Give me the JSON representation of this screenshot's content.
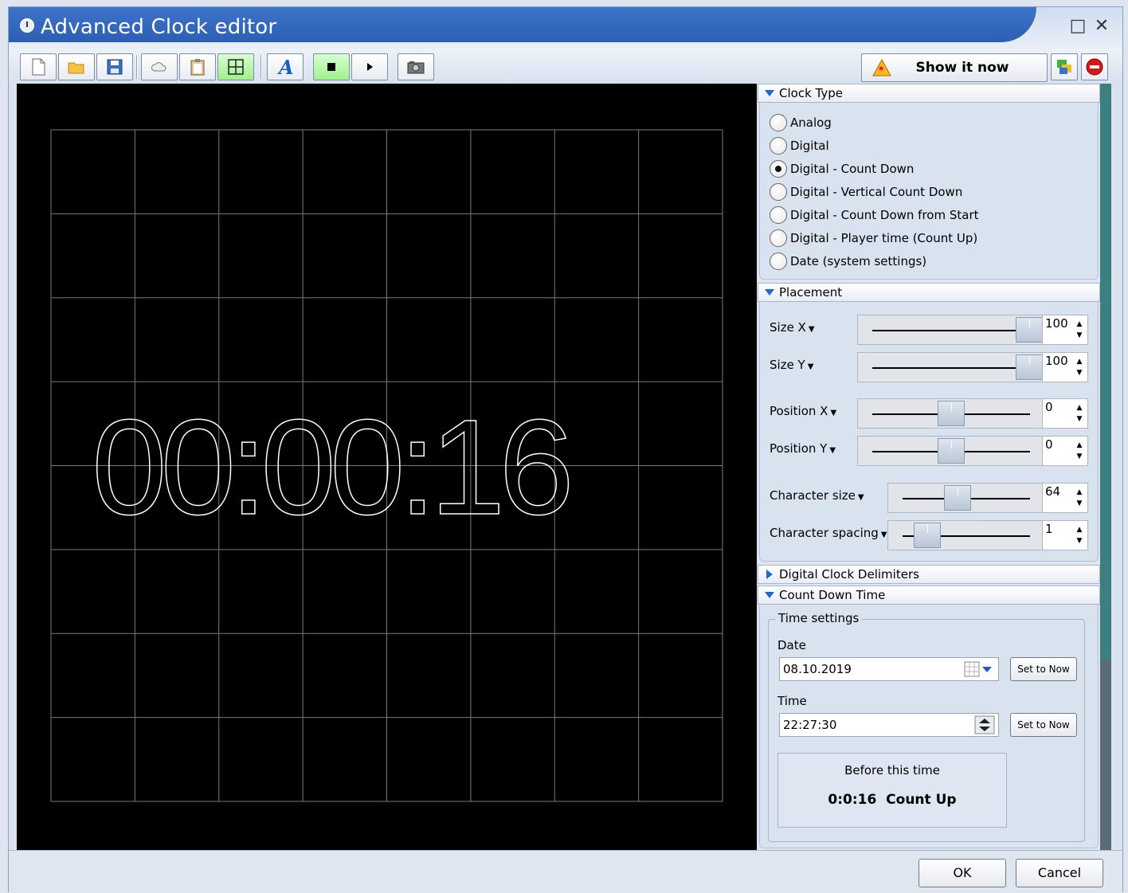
{
  "window": {
    "title": "Advanced Clock editor"
  },
  "toolbar": {
    "show_now_label": "Show it now"
  },
  "canvas": {
    "clock_text": "00:00:16",
    "grid": {
      "columns": 8,
      "rows": 8
    },
    "background": "#000000",
    "foreground": "#ffffff"
  },
  "clock_type": {
    "header": "Clock Type",
    "options": [
      {
        "label": "Analog",
        "checked": false
      },
      {
        "label": "Digital",
        "checked": false
      },
      {
        "label": "Digital - Count Down",
        "checked": true
      },
      {
        "label": "Digital - Vertical Count Down",
        "checked": false
      },
      {
        "label": "Digital - Count Down from Start",
        "checked": false
      },
      {
        "label": "Digital - Player time (Count Up)",
        "checked": false
      },
      {
        "label": "Date (system settings)",
        "checked": false
      }
    ]
  },
  "placement": {
    "header": "Placement",
    "size_x": {
      "label": "Size X",
      "value": "100"
    },
    "size_y": {
      "label": "Size Y",
      "value": "100"
    },
    "position_x": {
      "label": "Position X",
      "value": "0"
    },
    "position_y": {
      "label": "Position Y",
      "value": "0"
    },
    "char_size": {
      "label": "Character size",
      "value": "64"
    },
    "char_spacing": {
      "label": "Character spacing",
      "value": "1"
    }
  },
  "delimiters": {
    "header": "Digital Clock Delimiters"
  },
  "countdown": {
    "header": "Count Down Time",
    "group_label": "Time settings",
    "date_label": "Date",
    "date_value": "08.10.2019",
    "time_label": "Time",
    "time_value": "22:27:30",
    "set_now_label": "Set to Now",
    "info_line1": "Before this time",
    "info_line2": "0:0:16  Count Up"
  },
  "footer": {
    "ok_label": "OK",
    "cancel_label": "Cancel"
  },
  "colors": {
    "title_bar": "#2c5fb4",
    "accent": "#1a6ad6",
    "scrollbar": "#3b7f7f"
  }
}
